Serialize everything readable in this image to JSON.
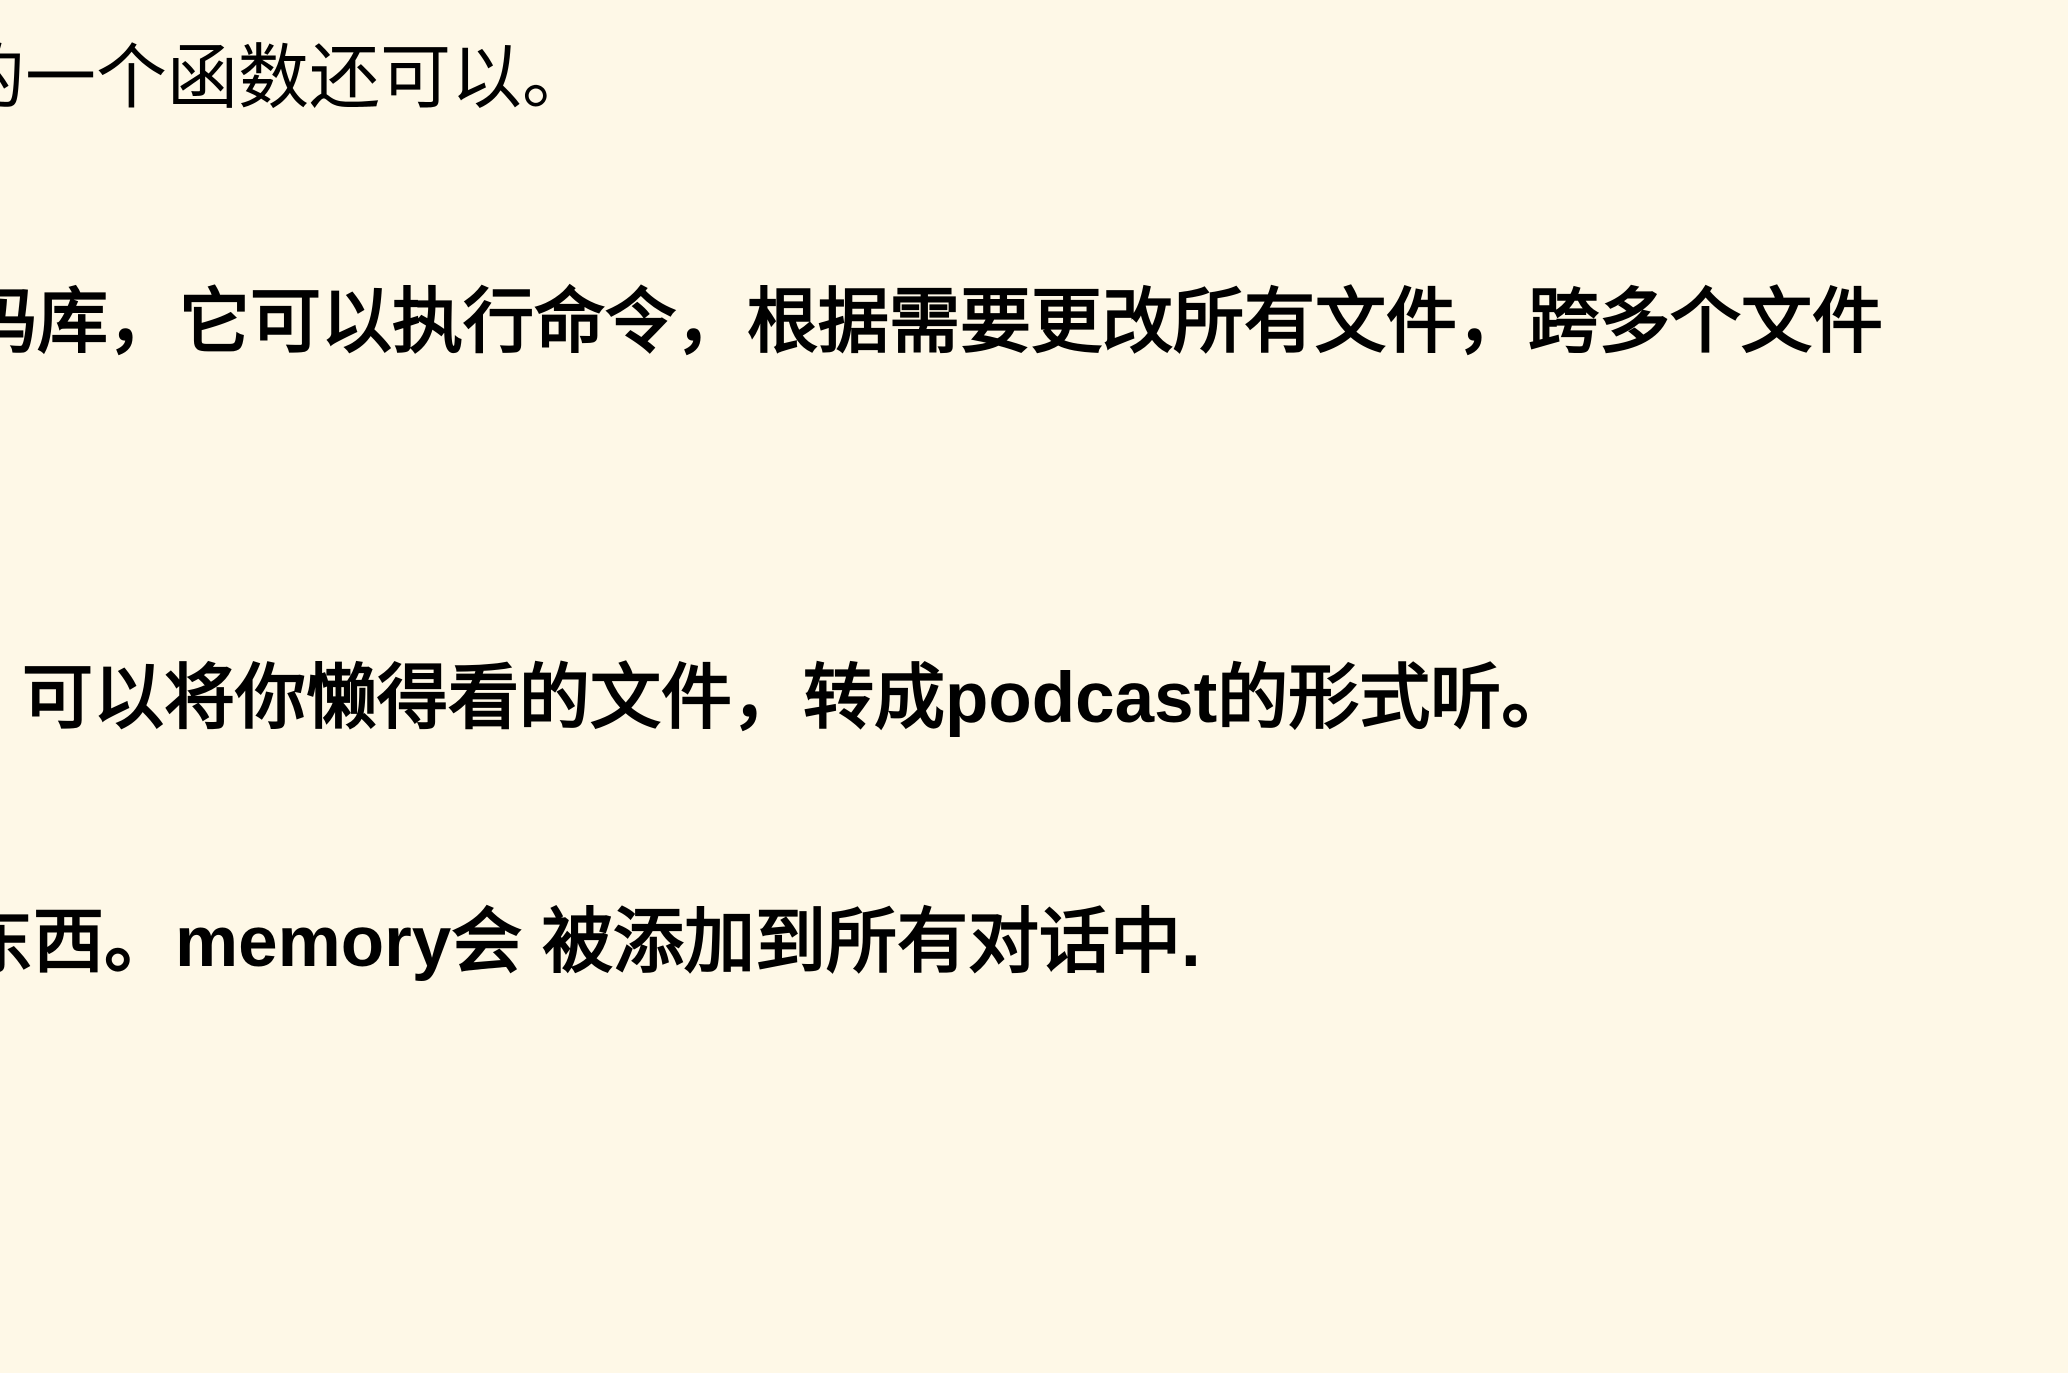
{
  "document": {
    "lines": [
      {
        "text": "的一个函数还可以。",
        "bold": false
      },
      {
        "text": "码库，它可以执行命令，根据需要更改所有文件，跨多个文件",
        "bold": true
      },
      {
        "text": "可以将你懒得看的文件，转成podcast的形式听。",
        "bold": true
      },
      {
        "text": "东西。memory会 被添加到所有对话中.",
        "bold": true
      }
    ]
  },
  "colors": {
    "background": "#fef8e7",
    "text": "#000000"
  }
}
